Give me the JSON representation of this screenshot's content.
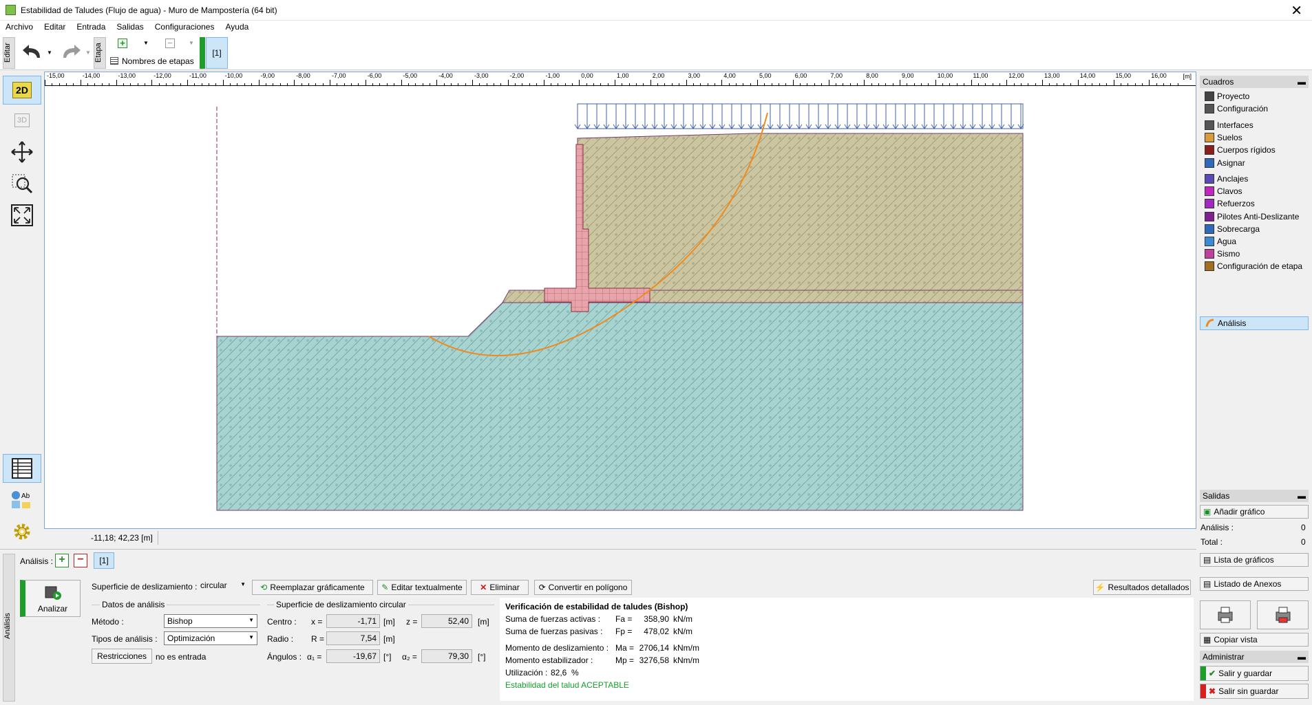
{
  "window": {
    "title": "Estabilidad de Taludes (Flujo de agua) - Muro de Mampostería (64 bit)",
    "close": "✕"
  },
  "menu": [
    "Archivo",
    "Editar",
    "Entrada",
    "Salidas",
    "Configuraciones",
    "Ayuda"
  ],
  "toolbar": {
    "edit_tab": "Editar",
    "stage_tab": "Etapa",
    "stage_names": "Nombres de etapas",
    "stage_current": "[1]"
  },
  "left_tools": {
    "btn_2d": "2D",
    "btn_3d": "3D"
  },
  "ruler": {
    "ticks": [
      "-15,00",
      "-14,00",
      "-13,00",
      "-12,00",
      "-11,00",
      "-10,00",
      "-9,00",
      "-8,00",
      "-7,00",
      "-6,00",
      "-5,00",
      "-4,00",
      "-3,00",
      "-2,00",
      "-1,00",
      "0,00",
      "1,00",
      "2,00",
      "3,00",
      "4,00",
      "5,00",
      "6,00",
      "7,00",
      "8,00",
      "9,00",
      "10,00",
      "11,00",
      "12,00",
      "13,00",
      "14,00",
      "15,00",
      "16,00"
    ],
    "unit": "[m]"
  },
  "status": {
    "coords": "-11,18; 42,23 [m]"
  },
  "right": {
    "cuadros_title": "Cuadros",
    "items_a": [
      "Proyecto",
      "Configuración"
    ],
    "items_b": [
      "Interfaces",
      "Suelos",
      "Cuerpos rígidos",
      "Asignar"
    ],
    "items_c": [
      "Anclajes",
      "Clavos",
      "Refuerzos",
      "Pilotes Anti-Deslizante",
      "Sobrecarga",
      "Agua",
      "Sismo",
      "Configuración de etapa"
    ],
    "analysis_item": "Análisis",
    "salidas_title": "Salidas",
    "add_graph": "Añadir gráfico",
    "analisis_label": "Análisis :",
    "analisis_count": "0",
    "total_label": "Total :",
    "total_count": "0",
    "list_graphs": "Lista de gráficos",
    "list_annex": "Listado de Anexos",
    "copy_view": "Copiar vista",
    "admin_title": "Administrar",
    "save_exit": "Salir y guardar",
    "exit_nosave": "Salir sin guardar"
  },
  "bottom": {
    "side_tab": "Análisis",
    "analysis_label": "Análisis :",
    "stage_btn": "[1]",
    "analyze_btn": "Analizar",
    "slip_surface_label": "Superficie de deslizamiento :",
    "slip_surface_value": "circular",
    "replace_btn": "Reemplazar gráficamente",
    "edit_text_btn": "Editar textualmente",
    "delete_btn": "Eliminar",
    "convert_btn": "Convertir en polígono",
    "detailed_btn": "Resultados detallados",
    "data_group": "Datos de análisis",
    "method_label": "Método :",
    "method_value": "Bishop",
    "types_label": "Tipos de análisis :",
    "types_value": "Optimización",
    "restrictions_btn": "Restricciones",
    "restrictions_value": "no es entrada",
    "circ_group": "Superficie de deslizamiento circular",
    "center_label": "Centro :",
    "x_label": "x =",
    "x_value": "-1,71",
    "x_unit": "[m]",
    "z_label": "z =",
    "z_value": "52,40",
    "z_unit": "[m]",
    "radius_label": "Radio :",
    "r_label": "R =",
    "r_value": "7,54",
    "r_unit": "[m]",
    "angles_label": "Ángulos :",
    "a1_label": "α₁ =",
    "a1_value": "-19,67",
    "a1_unit": "[°]",
    "a2_label": "α₂ =",
    "a2_value": "79,30",
    "a2_unit": "[°]",
    "results_title": "Verificación de estabilidad de taludes (Bishop)",
    "res1_label": "Suma de fuerzas activas :",
    "res1_sym": "Fa =",
    "res1_val": "358,90",
    "res1_unit": "kN/m",
    "res2_label": "Suma de fuerzas pasivas :",
    "res2_sym": "Fp =",
    "res2_val": "478,02",
    "res2_unit": "kN/m",
    "res3_label": "Momento de deslizamiento :",
    "res3_sym": "Ma =",
    "res3_val": "2706,14",
    "res3_unit": "kNm/m",
    "res4_label": "Momento estabilizador :",
    "res4_sym": "Mp =",
    "res4_val": "3276,58",
    "res4_unit": "kNm/m",
    "util_label": "Utilización :",
    "util_val": "82,6",
    "util_unit": "%",
    "verdict": "Estabilidad del talud ACEPTABLE"
  },
  "colors": {
    "accent": "#1e8c2c",
    "soil_upper": "#cbc6a0",
    "soil_lower": "#a7d3d0",
    "wall": "#e7a4aa",
    "slip": "#f08a1c",
    "load": "#3f5fa6",
    "verdict": "#16a02e"
  }
}
